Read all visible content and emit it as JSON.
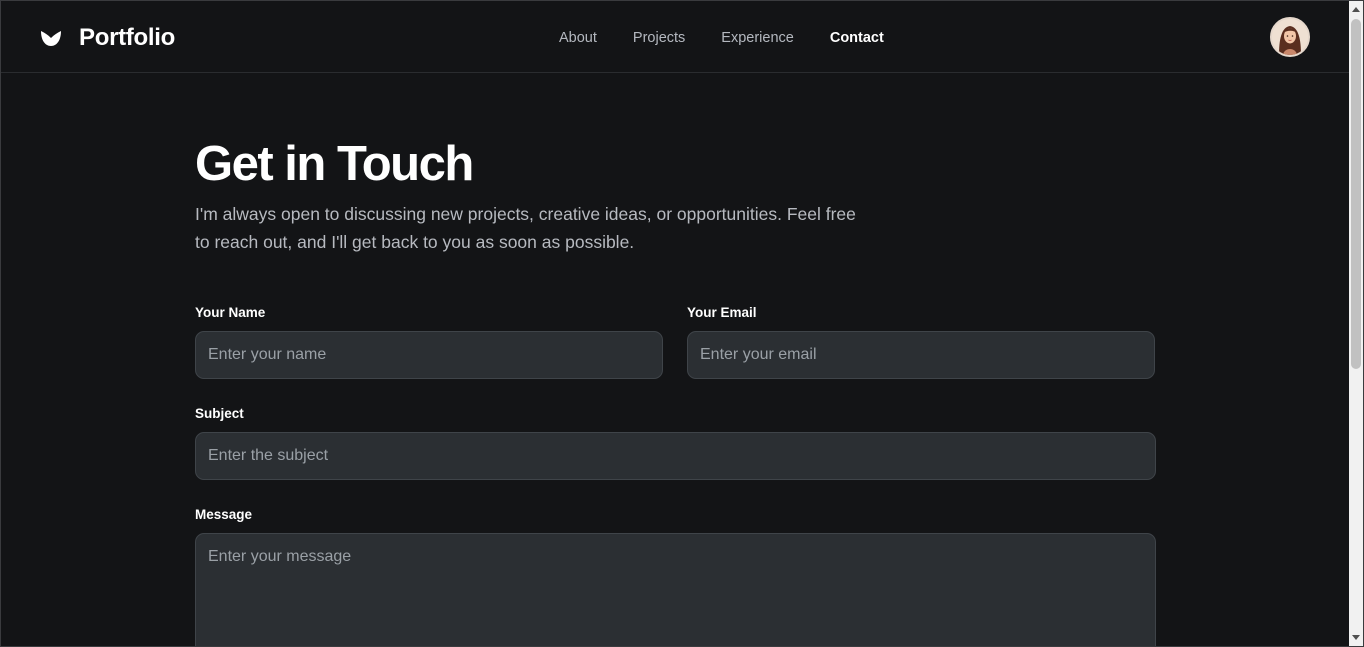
{
  "header": {
    "brand_title": "Portfolio",
    "brand_icon": "logo-icon",
    "nav": [
      {
        "label": "About",
        "active": false
      },
      {
        "label": "Projects",
        "active": false
      },
      {
        "label": "Experience",
        "active": false
      },
      {
        "label": "Contact",
        "active": true
      }
    ],
    "avatar_icon": "user-avatar"
  },
  "main": {
    "title": "Get in Touch",
    "intro": "I'm always open to discussing new projects, creative ideas, or opportunities. Feel free to reach out, and I'll get back to you as soon as possible."
  },
  "form": {
    "name": {
      "label": "Your Name",
      "placeholder": "Enter your name",
      "value": ""
    },
    "email": {
      "label": "Your Email",
      "placeholder": "Enter your email",
      "value": ""
    },
    "subject": {
      "label": "Subject",
      "placeholder": "Enter the subject",
      "value": ""
    },
    "message": {
      "label": "Message",
      "placeholder": "Enter your message",
      "value": ""
    }
  },
  "colors": {
    "background": "#131416",
    "input_background": "#2b2f33",
    "nav_inactive": "#b4b8bf",
    "nav_active": "#ffffff"
  }
}
